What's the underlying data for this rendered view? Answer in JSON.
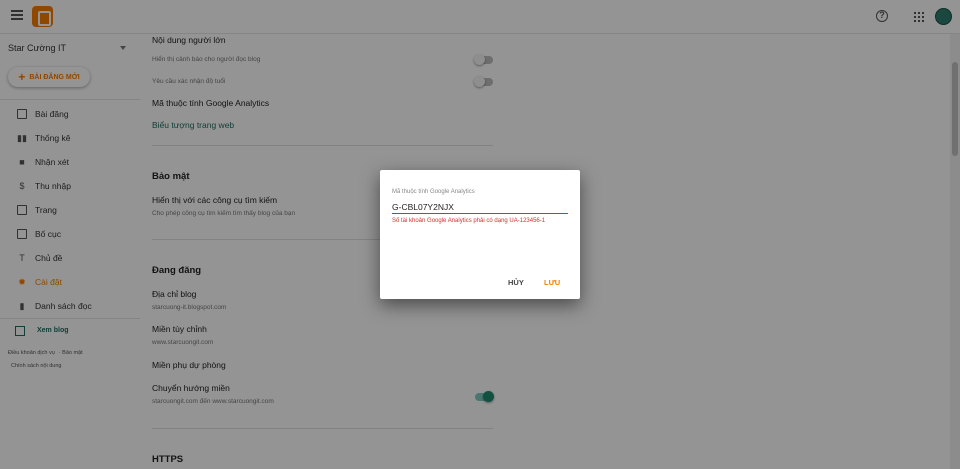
{
  "app": {
    "name": "Blogger"
  },
  "header": {
    "menu_icon": "hamburger-menu-icon",
    "help_icon": "help-circle-icon",
    "apps_icon": "apps-grid-icon"
  },
  "sidebar": {
    "blog_name": "Star Cường IT",
    "new_post_label": "BÀI ĐĂNG MỚI",
    "items": [
      {
        "label": "Bài đăng",
        "icon": "posts-icon"
      },
      {
        "label": "Thống kê",
        "icon": "stats-icon"
      },
      {
        "label": "Nhận xét",
        "icon": "comments-icon"
      },
      {
        "label": "Thu nhập",
        "icon": "earnings-icon"
      },
      {
        "label": "Trang",
        "icon": "pages-icon"
      },
      {
        "label": "Bố cục",
        "icon": "layout-icon"
      },
      {
        "label": "Chủ đề",
        "icon": "theme-icon"
      },
      {
        "label": "Cài đặt",
        "icon": "settings-icon",
        "active": true
      },
      {
        "label": "Danh sách đọc",
        "icon": "reading-list-icon"
      }
    ],
    "view_blog_label": "Xem blog",
    "footer_links": [
      "Điều khoản dịch vụ",
      "Bảo mật",
      "Chính sách nội dung"
    ]
  },
  "settings": {
    "adult_content": "Nội dung người lớn",
    "warning_readers": "Hiển thị cảnh báo cho người đọc blog",
    "age_confirm": "Yêu cầu xác nhận độ tuổi",
    "ga_property": "Mã thuộc tính Google Analytics",
    "favicon": "Biểu tượng trang web",
    "security_heading": "Bảo mật",
    "search_visible": "Hiển thị với các công cụ tìm kiếm",
    "search_visible_sub": "Cho phép công cụ tìm kiếm tìm thấy blog của bạn",
    "publishing_heading": "Đang đăng",
    "blog_address": "Địa chỉ blog",
    "blog_address_value": "starcuong-it.blogspot.com",
    "custom_domain": "Miền tùy chỉnh",
    "custom_domain_value": "www.starcuongit.com",
    "fallback_domain": "Miền phụ dự phòng",
    "redirect_domain": "Chuyển hướng miền",
    "redirect_domain_value": "starcuongit.com đến www.starcuongit.com",
    "https_heading": "HTTPS"
  },
  "dialog": {
    "label": "Mã thuộc tính Google Analytics",
    "value": "G-CBL07Y2NJX",
    "error": "Số tài khoản Google Analytics phải có dạng UA-123456-1",
    "cancel_label": "HỦY",
    "save_label": "LƯU"
  },
  "colors": {
    "brand": "#f57d00",
    "teal": "#1f6b5e",
    "error": "#d32f2f"
  }
}
